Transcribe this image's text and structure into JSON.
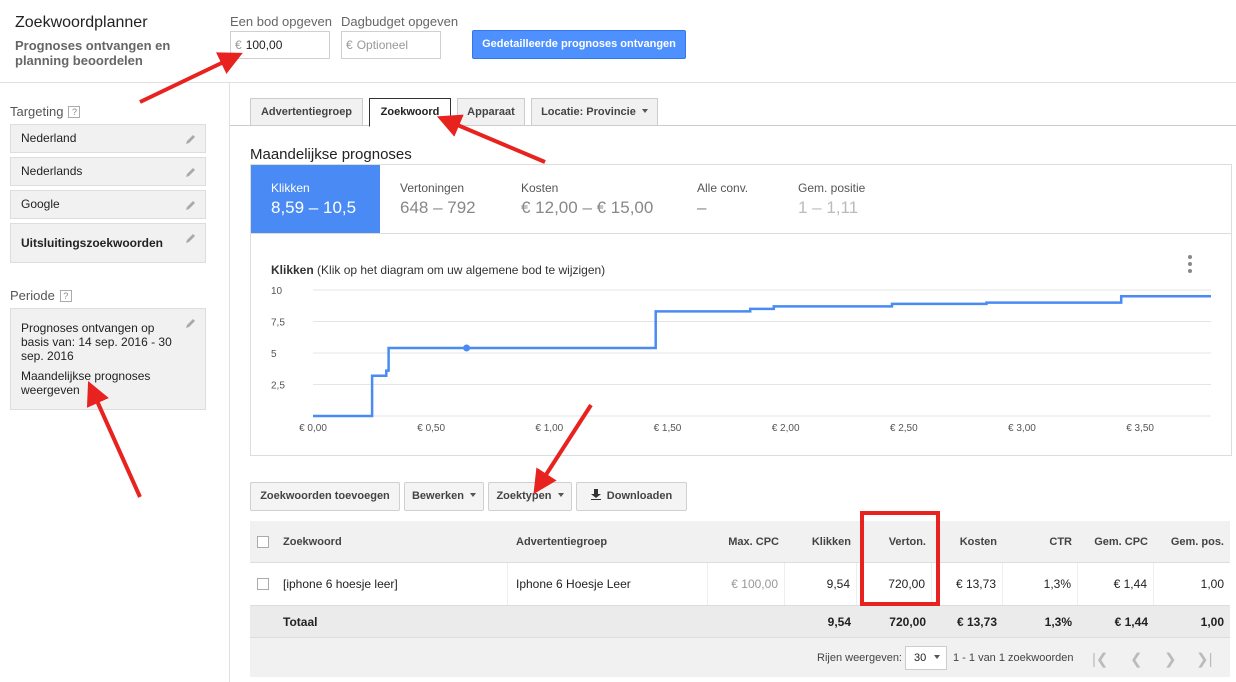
{
  "header": {
    "title": "Zoekwoordplanner",
    "subtitle": "Prognoses ontvangen en planning beoordelen",
    "bid_label": "Een bod opgeven",
    "bid_currency": "€",
    "bid_value": "100,00",
    "budget_label": "Dagbudget opgeven",
    "budget_currency": "€",
    "budget_placeholder": "Optioneel",
    "primary_button": "Gedetailleerde prognoses ontvangen"
  },
  "sidebar": {
    "targeting_heading": "Targeting",
    "help_glyph": "?",
    "targeting_items": [
      {
        "label": "Nederland"
      },
      {
        "label": "Nederlands"
      },
      {
        "label": "Google"
      },
      {
        "label": "Uitsluitingszoekwoorden"
      }
    ],
    "period_heading": "Periode",
    "period_text": "Prognoses ontvangen op basis van: 14 sep. 2016 - 30 sep. 2016",
    "period_mode": "Maandelijkse prognoses weergeven"
  },
  "tabs": [
    {
      "label": "Advertentiegroep",
      "active": false
    },
    {
      "label": "Zoekwoord",
      "active": true
    },
    {
      "label": "Apparaat",
      "active": false
    },
    {
      "label": "Locatie: Provincie",
      "active": false
    }
  ],
  "section_title": "Maandelijkse prognoses",
  "metrics": [
    {
      "label": "Klikken",
      "value": "8,59 – 10,5"
    },
    {
      "label": "Vertoningen",
      "value": "648 – 792"
    },
    {
      "label": "Kosten",
      "value": "€ 12,00 – € 15,00"
    },
    {
      "label": "Alle conv.",
      "value": "–"
    },
    {
      "label": "Gem. positie",
      "value": "1 – 1,11"
    }
  ],
  "chart": {
    "title_bold": "Klikken",
    "title_rest": "(Klik op het diagram om uw algemene bod te wijzigen)"
  },
  "chart_data": {
    "type": "line",
    "title": "Klikken (Klik op het diagram om uw algemene bod te wijzigen)",
    "xlabel": "",
    "ylabel": "",
    "x_ticks": [
      "€ 0,00",
      "€ 0,50",
      "€ 1,00",
      "€ 1,50",
      "€ 2,00",
      "€ 2,50",
      "€ 3,00",
      "€ 3,50"
    ],
    "y_ticks": [
      "2,5",
      "5",
      "7,5",
      "10"
    ],
    "xlim": [
      0,
      3.8
    ],
    "ylim": [
      0,
      10
    ],
    "grid": true,
    "legend": "none",
    "step": true,
    "series": [
      {
        "color": "#4a8af4",
        "points": [
          [
            0.0,
            0
          ],
          [
            0.25,
            0
          ],
          [
            0.25,
            3.2
          ],
          [
            0.31,
            3.2
          ],
          [
            0.31,
            3.6
          ],
          [
            0.32,
            3.6
          ],
          [
            0.32,
            5.4
          ],
          [
            1.45,
            5.4
          ],
          [
            1.45,
            8.3
          ],
          [
            1.85,
            8.3
          ],
          [
            1.85,
            8.5
          ],
          [
            1.95,
            8.5
          ],
          [
            1.95,
            8.7
          ],
          [
            2.45,
            8.7
          ],
          [
            2.45,
            8.9
          ],
          [
            2.85,
            8.9
          ],
          [
            2.85,
            9.0
          ],
          [
            3.42,
            9.0
          ],
          [
            3.42,
            9.5
          ],
          [
            3.8,
            9.5
          ]
        ],
        "marker": [
          0.65,
          5.4
        ]
      }
    ]
  },
  "toolbar": {
    "add_keywords": "Zoekwoorden toevoegen",
    "edit": "Bewerken",
    "match_types": "Zoektypen",
    "download": "Downloaden"
  },
  "table": {
    "headers": [
      "Zoekwoord",
      "Advertentiegroep",
      "Max. CPC",
      "Klikken",
      "Verton.",
      "Kosten",
      "CTR",
      "Gem. CPC",
      "Gem. pos."
    ],
    "rows": [
      [
        "[iphone 6 hoesje leer]",
        "Iphone 6 Hoesje Leer",
        "€ 100,00",
        "9,54",
        "720,00",
        "€ 13,73",
        "1,3%",
        "€ 1,44",
        "1,00"
      ]
    ],
    "totals": [
      "Totaal",
      "",
      "",
      "9,54",
      "720,00",
      "€ 13,73",
      "1,3%",
      "€ 1,44",
      "1,00"
    ]
  },
  "footer": {
    "rows_label": "Rijen weergeven:",
    "rows_value": "30",
    "range_text": "1 - 1 van 1 zoekwoorden"
  },
  "colors": {
    "accent": "#4a8af4",
    "primary_button": "#4d90fe",
    "annotation": "#e8231f"
  }
}
